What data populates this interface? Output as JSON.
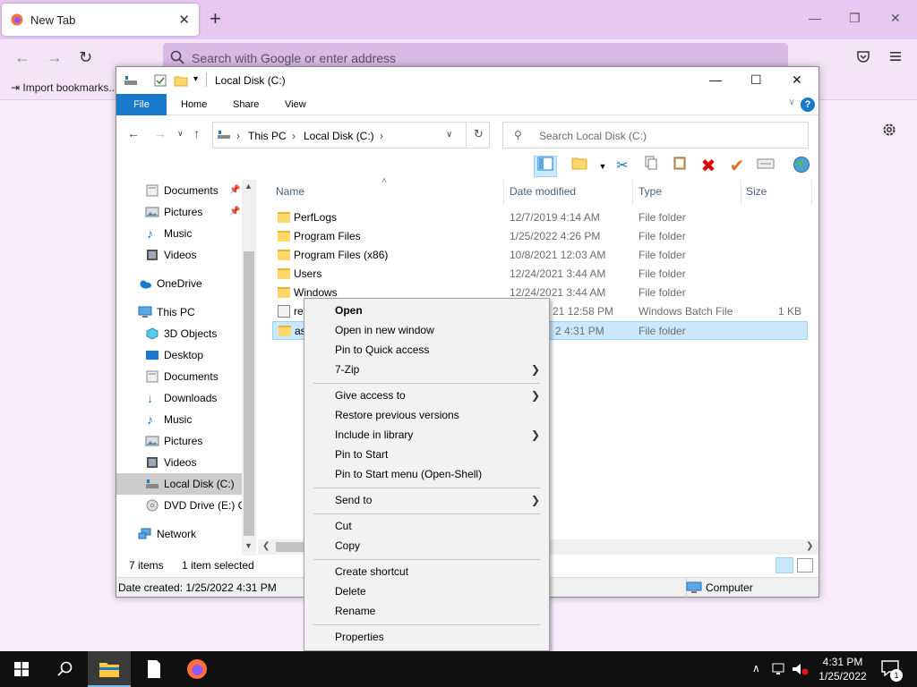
{
  "browser": {
    "tab_title": "New Tab",
    "tab_close": "✕",
    "new_tab": "+",
    "address_placeholder": "Search with Google or enter address",
    "bookmark": "Import bookmarks...",
    "minimize": "—",
    "restore": "❐",
    "close": "✕"
  },
  "explorer": {
    "title": "Local Disk (C:)",
    "ribbon_tabs": [
      "File",
      "Home",
      "Share",
      "View"
    ],
    "help": "?",
    "breadcrumb": [
      "This PC",
      "Local Disk (C:)"
    ],
    "search_placeholder": "Search Local Disk (C:)",
    "nav_items": [
      {
        "label": "Documents",
        "pinned": true
      },
      {
        "label": "Pictures",
        "pinned": true
      },
      {
        "label": "Music"
      },
      {
        "label": "Videos"
      },
      {
        "label": "OneDrive"
      },
      {
        "label": "This PC"
      },
      {
        "label": "3D Objects"
      },
      {
        "label": "Desktop"
      },
      {
        "label": "Documents"
      },
      {
        "label": "Downloads"
      },
      {
        "label": "Music"
      },
      {
        "label": "Pictures"
      },
      {
        "label": "Videos"
      },
      {
        "label": "Local Disk (C:)",
        "selected": true
      },
      {
        "label": "DVD Drive (E:) CI"
      },
      {
        "label": "Network"
      }
    ],
    "columns": [
      "Name",
      "Date modified",
      "Type",
      "Size"
    ],
    "files": [
      {
        "name": "PerfLogs",
        "date": "12/7/2019 4:14 AM",
        "type": "File folder",
        "size": ""
      },
      {
        "name": "Program Files",
        "date": "1/25/2022 4:26 PM",
        "type": "File folder",
        "size": ""
      },
      {
        "name": "Program Files (x86)",
        "date": "10/8/2021 12:03 AM",
        "type": "File folder",
        "size": ""
      },
      {
        "name": "Users",
        "date": "12/24/2021 3:44 AM",
        "type": "File folder",
        "size": ""
      },
      {
        "name": "Windows",
        "date": "12/24/2021 3:44 AM",
        "type": "File folder",
        "size": ""
      },
      {
        "name": "re",
        "date": "21 12:58 PM",
        "type": "Windows Batch File",
        "size": "1 KB"
      },
      {
        "name": "as",
        "date": "2 4:31 PM",
        "type": "File folder",
        "size": "",
        "selected": true
      }
    ],
    "status": {
      "items": "7 items",
      "selected": "1 item selected",
      "date_created": "Date created: 1/25/2022 4:31 PM",
      "computer": "Computer"
    }
  },
  "context_menu": {
    "items": [
      {
        "label": "Open",
        "bold": true
      },
      {
        "label": "Open in new window"
      },
      {
        "label": "Pin to Quick access"
      },
      {
        "label": "7-Zip",
        "submenu": true
      },
      {
        "sep": true
      },
      {
        "label": "Give access to",
        "submenu": true
      },
      {
        "label": "Restore previous versions"
      },
      {
        "label": "Include in library",
        "submenu": true
      },
      {
        "label": "Pin to Start"
      },
      {
        "label": "Pin to Start menu (Open-Shell)"
      },
      {
        "sep": true
      },
      {
        "label": "Send to",
        "submenu": true
      },
      {
        "sep": true
      },
      {
        "label": "Cut"
      },
      {
        "label": "Copy"
      },
      {
        "sep": true
      },
      {
        "label": "Create shortcut"
      },
      {
        "label": "Delete"
      },
      {
        "label": "Rename"
      },
      {
        "sep": true
      },
      {
        "label": "Properties"
      }
    ]
  },
  "taskbar": {
    "time": "4:31 PM",
    "date": "1/25/2022",
    "notification_count": "1"
  }
}
